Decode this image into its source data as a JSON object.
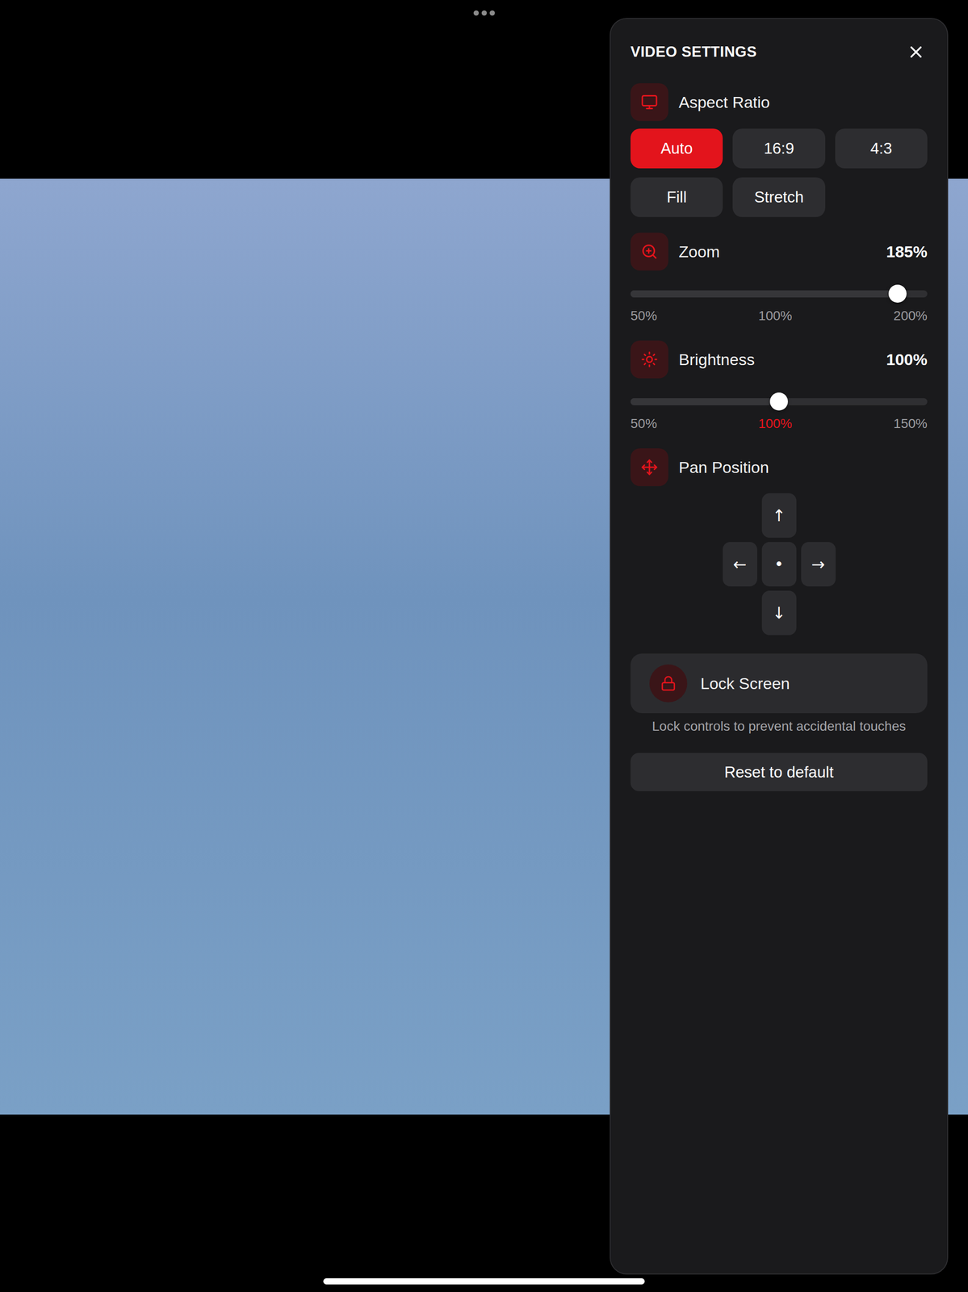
{
  "panel": {
    "title": "VIDEO SETTINGS"
  },
  "aspect_ratio": {
    "label": "Aspect Ratio",
    "options": [
      {
        "label": "Auto",
        "selected": true
      },
      {
        "label": "16:9",
        "selected": false
      },
      {
        "label": "4:3",
        "selected": false
      },
      {
        "label": "Fill",
        "selected": false
      },
      {
        "label": "Stretch",
        "selected": false
      }
    ]
  },
  "sliders": [
    {
      "label": "Zoom",
      "reading": "185%",
      "level": 0.9,
      "ticks": [
        {
          "label": "50%",
          "selected": false
        },
        {
          "label": "100%",
          "selected": false
        },
        {
          "label": "200%",
          "selected": false
        }
      ]
    },
    {
      "label": "Brightness",
      "reading": "100%",
      "level": 0.5,
      "ticks": [
        {
          "label": "50%",
          "selected": false
        },
        {
          "label": "100%",
          "selected": true
        },
        {
          "label": "150%",
          "selected": false
        }
      ]
    }
  ],
  "pan": {
    "label": "Pan Position",
    "buttons": {
      "up": "↑",
      "left": "←",
      "center": "•",
      "right": "→",
      "down": "↓"
    }
  },
  "lock": {
    "label": "Lock Screen",
    "caption": "Lock controls to prevent accidental touches"
  },
  "reset": {
    "label": "Reset to default"
  }
}
